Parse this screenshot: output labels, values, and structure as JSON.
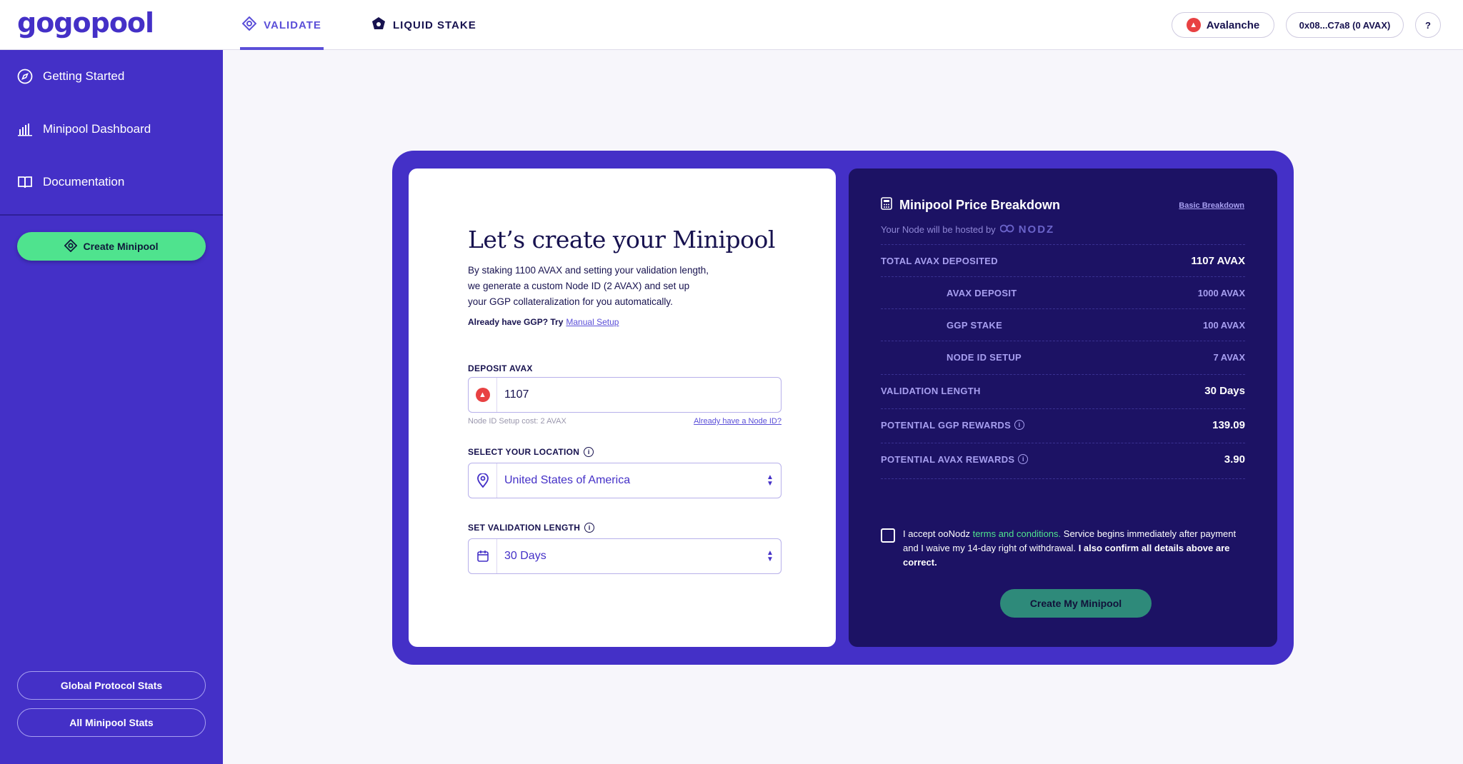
{
  "app": {
    "logo": "gogopool"
  },
  "topnav": {
    "tabs": [
      {
        "label": "VALIDATE",
        "icon": "validate-diamond-icon",
        "active": true
      },
      {
        "label": "LIQUID STAKE",
        "icon": "liquid-stake-icon",
        "active": false
      }
    ],
    "network_label": "Avalanche",
    "wallet_label": "0x08...C7a8 (0 AVAX)",
    "help_label": "?"
  },
  "sidebar": {
    "items": [
      {
        "label": "Getting Started",
        "icon": "compass-icon"
      },
      {
        "label": "Minipool Dashboard",
        "icon": "bar-chart-icon"
      },
      {
        "label": "Documentation",
        "icon": "book-icon"
      }
    ],
    "create_label": "Create Minipool",
    "global_stats_label": "Global Protocol Stats",
    "all_stats_label": "All Minipool Stats"
  },
  "form": {
    "title": "Let’s create your Minipool",
    "intro": "By staking 1100 AVAX and setting your validation length, we generate a custom Node ID (2 AVAX) and set up your GGP collateralization for you automatically.",
    "already_text": "Already have GGP? Try",
    "manual_setup_label": "Manual Setup",
    "deposit_label": "DEPOSIT AVAX",
    "deposit_value": "1107",
    "deposit_hint": "Node ID Setup cost: 2 AVAX",
    "node_id_link": "Already have a Node ID?",
    "location_label": "SELECT YOUR LOCATION",
    "location_value": "United States of America",
    "length_label": "SET VALIDATION LENGTH",
    "length_value": "30 Days"
  },
  "breakdown": {
    "title": "Minipool Price Breakdown",
    "basic_link": "Basic Breakdown",
    "hosted_text": "Your Node will be hosted by",
    "host_brand": "NODZ",
    "rows": [
      {
        "label": "TOTAL AVAX DEPOSITED",
        "value": "1107 AVAX"
      },
      {
        "label": "AVAX DEPOSIT",
        "value": "1000 AVAX"
      },
      {
        "label": "GGP STAKE",
        "value": "100 AVAX"
      },
      {
        "label": "NODE ID SETUP",
        "value": "7 AVAX"
      },
      {
        "label": "VALIDATION LENGTH",
        "value": "30 Days"
      },
      {
        "label": "POTENTIAL GGP REWARDS",
        "value": "139.09"
      },
      {
        "label": "POTENTIAL AVAX REWARDS",
        "value": "3.90"
      }
    ],
    "terms_prefix": "I accept ooNodz",
    "terms_link": "terms and conditions.",
    "terms_middle": "Service begins immediately after payment and I waive my 14-day right of withdrawal.",
    "terms_bold": "I also confirm all details above are correct.",
    "cta_label": "Create My Minipool"
  },
  "colors": {
    "brand_purple": "#4430c7",
    "panel_dark": "#1c1264",
    "accent_green": "#4fe38e",
    "cta_teal": "#2e8a7a"
  }
}
